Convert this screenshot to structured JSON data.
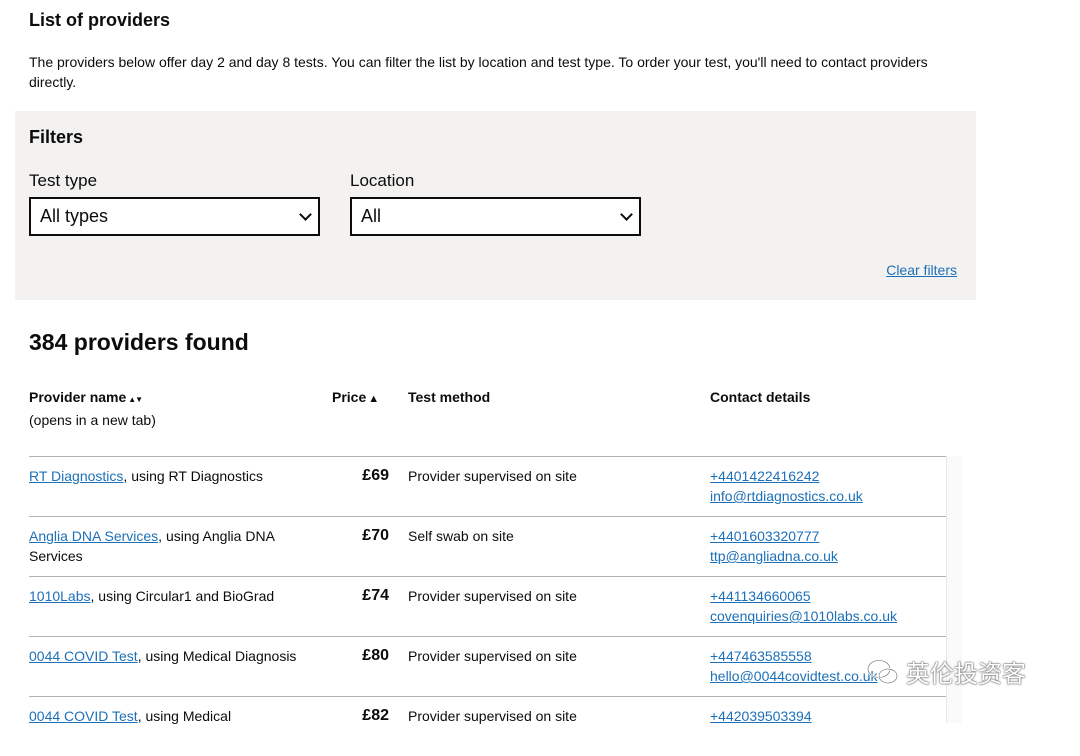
{
  "heading": "List of providers",
  "intro": "The providers below offer day 2 and day 8 tests. You can filter the list by location and test type. To order your test, you'll need to contact providers directly.",
  "filters": {
    "title": "Filters",
    "test_type": {
      "label": "Test type",
      "value": "All types"
    },
    "location": {
      "label": "Location",
      "value": "All"
    },
    "clear": "Clear filters"
  },
  "results_count": "384 providers found",
  "columns": {
    "provider": "Provider name",
    "provider_arrow": "▲▼",
    "provider_sub": "(opens in a new tab)",
    "price": "Price",
    "price_arrow": "▲",
    "method": "Test method",
    "contact": "Contact details"
  },
  "rows": [
    {
      "name": "RT Diagnostics",
      "using": ", using RT Diagnostics",
      "price": "£69",
      "method": "Provider supervised on site",
      "phone": "+4401422416242",
      "email": "info@rtdiagnostics.co.uk"
    },
    {
      "name": "Anglia DNA Services",
      "using": ", using Anglia DNA Services",
      "price": "£70",
      "method": "Self swab on site",
      "phone": "+4401603320777",
      "email": "ttp@angliadna.co.uk"
    },
    {
      "name": "1010Labs",
      "using": ", using Circular1 and BioGrad",
      "price": "£74",
      "method": "Provider supervised on site",
      "phone": "+441134660065",
      "email": "covenquiries@1010labs.co.uk"
    },
    {
      "name": "0044 COVID Test",
      "using": ", using Medical Diagnosis",
      "price": "£80",
      "method": "Provider supervised on site",
      "phone": "+447463585558",
      "email": "hello@0044covidtest.co.uk"
    },
    {
      "name": "0044 COVID Test",
      "using": ", using Medical",
      "price": "£82",
      "method": "Provider supervised on site",
      "phone": "+442039503394",
      "email": ""
    }
  ],
  "watermark": "英伦投资客"
}
